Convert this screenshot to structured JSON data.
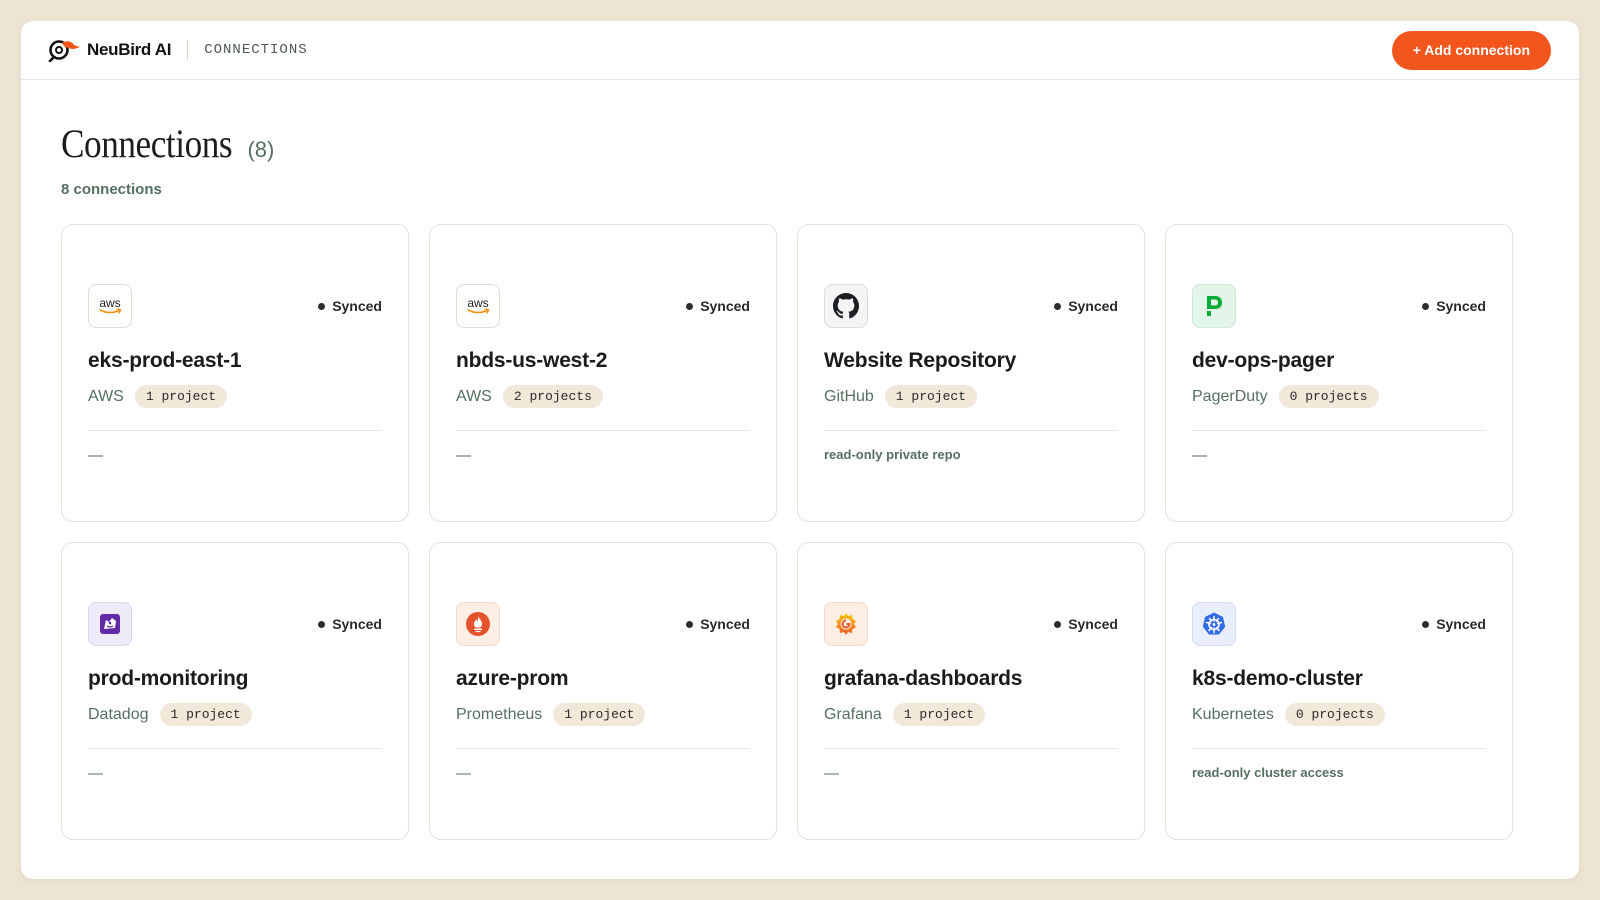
{
  "brand": {
    "name": "NeuBird AI"
  },
  "topbar": {
    "section": "CONNECTIONS",
    "add_button": "+ Add connection"
  },
  "page": {
    "title": "Connections",
    "count": "(8)",
    "subtitle": "8 connections"
  },
  "colors": {
    "accent": "#f2561d",
    "muted_green": "#557060",
    "badge_bg": "#f1e8d9",
    "page_bg": "#ede4d4"
  },
  "cards": [
    {
      "name": "eks-prod-east-1",
      "provider": "AWS",
      "projects": "1 project",
      "status": "Synced",
      "note": "—",
      "icon": "aws-icon"
    },
    {
      "name": "nbds-us-west-2",
      "provider": "AWS",
      "projects": "2 projects",
      "status": "Synced",
      "note": "—",
      "icon": "aws-icon"
    },
    {
      "name": "Website Repository",
      "provider": "GitHub",
      "projects": "1 project",
      "status": "Synced",
      "note": "read-only private repo",
      "icon": "github-icon"
    },
    {
      "name": "dev-ops-pager",
      "provider": "PagerDuty",
      "projects": "0 projects",
      "status": "Synced",
      "note": "—",
      "icon": "pagerduty-icon"
    },
    {
      "name": "prod-monitoring",
      "provider": "Datadog",
      "projects": "1 project",
      "status": "Synced",
      "note": "—",
      "icon": "datadog-icon"
    },
    {
      "name": "azure-prom",
      "provider": "Prometheus",
      "projects": "1 project",
      "status": "Synced",
      "note": "—",
      "icon": "prometheus-icon"
    },
    {
      "name": "grafana-dashboards",
      "provider": "Grafana",
      "projects": "1 project",
      "status": "Synced",
      "note": "—",
      "icon": "grafana-icon"
    },
    {
      "name": "k8s-demo-cluster",
      "provider": "Kubernetes",
      "projects": "0 projects",
      "status": "Synced",
      "note": "read-only cluster access",
      "icon": "kubernetes-icon"
    }
  ]
}
